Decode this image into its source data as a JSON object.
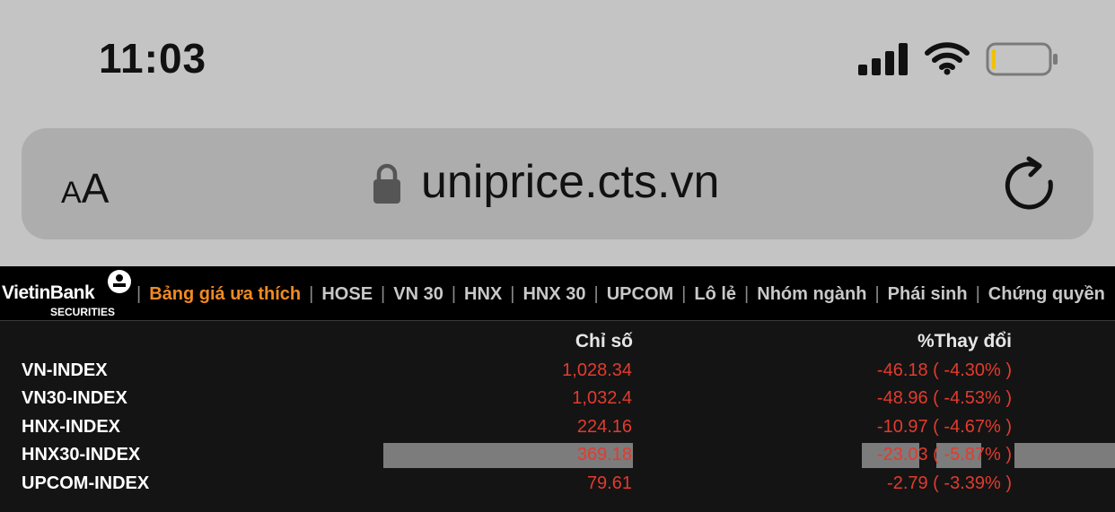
{
  "status_bar": {
    "time": "11:03"
  },
  "browser": {
    "aa_small": "A",
    "aa_big": "A",
    "url": "uniprice.cts.vn"
  },
  "logo": {
    "name": "VietinBank",
    "sub": "SECURITIES"
  },
  "nav": {
    "items": [
      {
        "label": "Bảng giá ưa thích",
        "active": true
      },
      {
        "label": "HOSE"
      },
      {
        "label": "VN 30"
      },
      {
        "label": "HNX"
      },
      {
        "label": "HNX 30"
      },
      {
        "label": "UPCOM"
      },
      {
        "label": "Lô lẻ"
      },
      {
        "label": "Nhóm ngành"
      },
      {
        "label": "Phái sinh"
      },
      {
        "label": "Chứng quyền"
      }
    ]
  },
  "table": {
    "headers": {
      "index": "Chỉ số",
      "change": "%Thay đổi"
    },
    "rows": [
      {
        "name": "VN-INDEX",
        "value": "1,028.34",
        "change": "-46.18",
        "percent": "-4.30%"
      },
      {
        "name": "VN30-INDEX",
        "value": "1,032.4",
        "change": "-48.96",
        "percent": "-4.53%"
      },
      {
        "name": "HNX-INDEX",
        "value": "224.16",
        "change": "-10.97",
        "percent": "-4.67%"
      },
      {
        "name": "HNX30-INDEX",
        "value": "369.18",
        "change": "-23.03",
        "percent": "-5.87%",
        "highlight": true
      },
      {
        "name": "UPCOM-INDEX",
        "value": "79.61",
        "change": "-2.79",
        "percent": "-3.39%"
      }
    ]
  },
  "colors": {
    "down": "#e23b2e",
    "active_tab": "#f08a24",
    "highlight": "#7c7c7c"
  }
}
